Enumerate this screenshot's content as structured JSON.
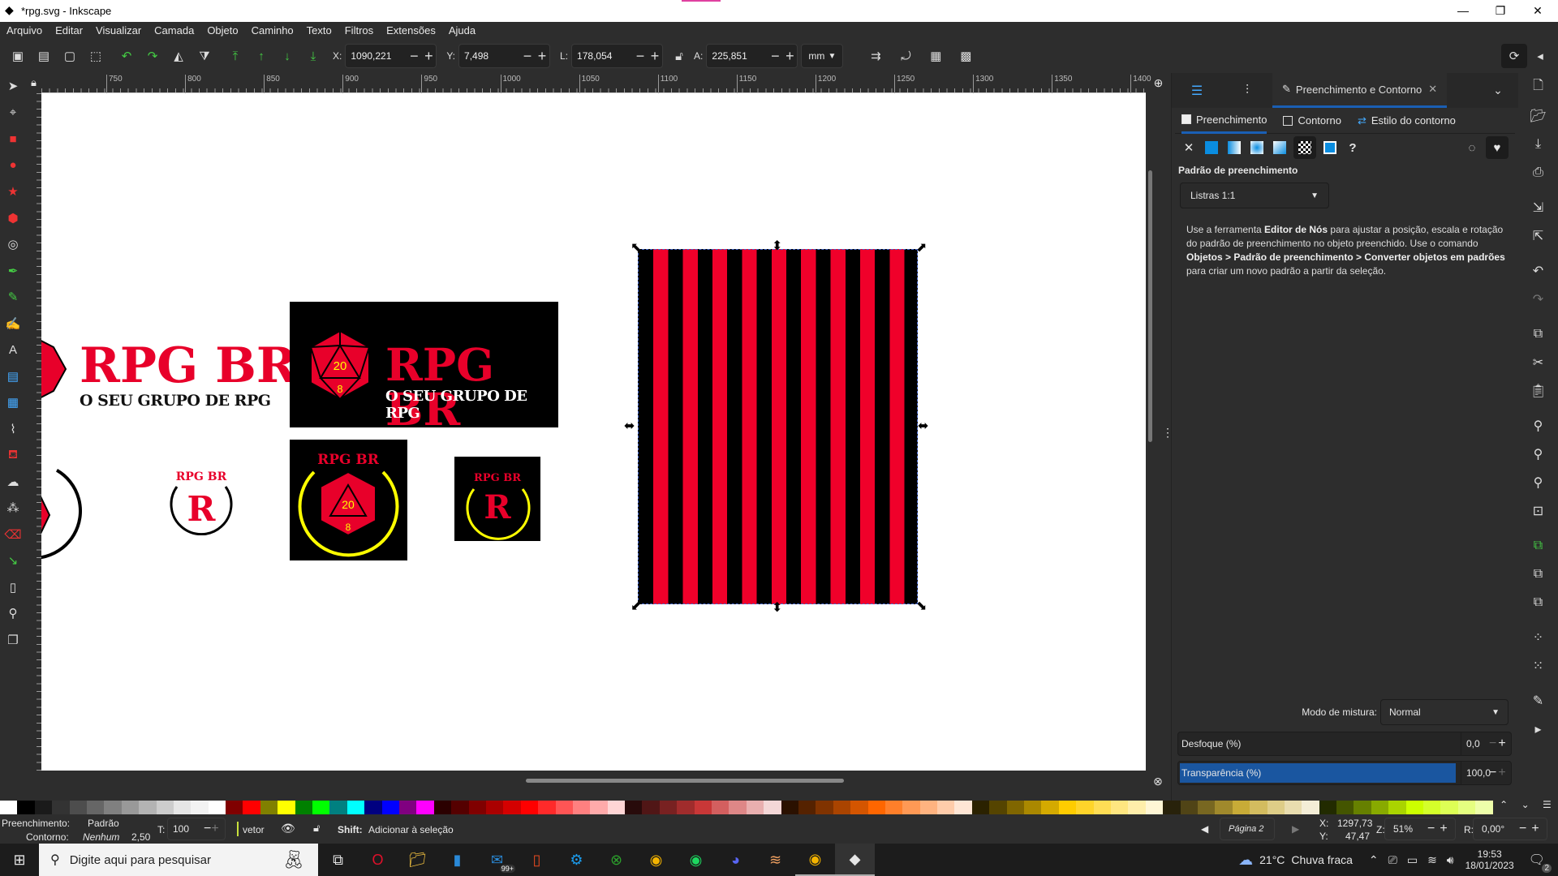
{
  "window": {
    "title": "*rpg.svg - Inkscape",
    "minimize": "—",
    "maximize": "❐",
    "close": "✕"
  },
  "menu": [
    "Arquivo",
    "Editar",
    "Visualizar",
    "Camada",
    "Objeto",
    "Caminho",
    "Texto",
    "Filtros",
    "Extensões",
    "Ajuda"
  ],
  "toolbar": {
    "x_label": "X:",
    "x": "1090,221",
    "y_label": "Y:",
    "y": "7,498",
    "w_label": "L:",
    "w": "178,054",
    "h_label": "A:",
    "h": "225,851",
    "unit": "mm",
    "minus": "−",
    "plus": "+"
  },
  "ruler": {
    "top_labels": [
      "750",
      "800",
      "850",
      "900",
      "950",
      "1000",
      "1050",
      "1100",
      "1150",
      "1200",
      "1250",
      "1300",
      "1350",
      "1400"
    ]
  },
  "canvas": {
    "logo_title": "RPG BR",
    "logo_subtitle": "O SEU GRUPO DE RPG",
    "badge_letter": "R",
    "die_faces": {
      "top": "20",
      "bottom": "8"
    },
    "colors": {
      "red": "#e8002a",
      "black": "#000000",
      "yellow": "#ffee00"
    },
    "stripes": {
      "pattern": "Listras 1:1",
      "colors": [
        "#000000",
        "#f0002a"
      ]
    }
  },
  "panel": {
    "tab_label": "Preenchimento e Contorno",
    "tab_close": "✕",
    "subtabs": [
      "Preenchimento",
      "Contorno",
      "Estilo do contorno"
    ],
    "fill_types": [
      "x-icon",
      "flat-color",
      "linear-gradient",
      "radial-gradient",
      "mesh-gradient",
      "pattern",
      "swatch",
      "unset"
    ],
    "selected_fill_type": "pattern",
    "section_title": "Padrão de preenchimento",
    "pattern_value": "Listras 1:1",
    "help": {
      "p1": "Use a ferramenta ",
      "b1": "Editor de Nós",
      "p2": " para ajustar a posição, escala e rotação do padrão de preenchimento no objeto preenchido. Use o comando ",
      "b2": "Objetos > Padrão de preenchimento > Converter objetos em padrões",
      "p3": " para criar um novo padrão a partir da seleção."
    },
    "blend_label": "Modo de mistura:",
    "blend_value": "Normal",
    "blur_label": "Desfoque (%)",
    "blur_value": "0,0",
    "blur_level": 0,
    "opacity_label": "Transparência (%)",
    "opacity_value": "100,0",
    "opacity_level": 100
  },
  "palette": [
    "#ffffff",
    "#000000",
    "#1a1a1a",
    "#333333",
    "#4d4d4d",
    "#666666",
    "#808080",
    "#999999",
    "#b3b3b3",
    "#cccccc",
    "#e6e6e6",
    "#f2f2f2",
    "#ffffff",
    "#800000",
    "#ff0000",
    "#808000",
    "#ffff00",
    "#008000",
    "#00ff00",
    "#008080",
    "#00ffff",
    "#000080",
    "#0000ff",
    "#800080",
    "#ff00ff",
    "#2b0000",
    "#550000",
    "#800000",
    "#aa0000",
    "#d40000",
    "#ff0000",
    "#ff2a2a",
    "#ff5555",
    "#ff8080",
    "#ffaaaa",
    "#ffd5d5",
    "#280b0b",
    "#501616",
    "#782121",
    "#a02c2c",
    "#c83737",
    "#d35f5f",
    "#de8787",
    "#e9afaf",
    "#f4d7d7",
    "#2b1100",
    "#552200",
    "#803300",
    "#aa4400",
    "#d45500",
    "#ff6600",
    "#ff7f2a",
    "#ff9955",
    "#ffb380",
    "#ffccaa",
    "#ffe6d5",
    "#2b2200",
    "#554400",
    "#806600",
    "#aa8800",
    "#d4aa00",
    "#ffcc00",
    "#ffd42a",
    "#ffdd55",
    "#ffe680",
    "#ffeeaa",
    "#fff6d5",
    "#28220b",
    "#504416",
    "#786721",
    "#a0892c",
    "#c8ab37",
    "#d3bc5f",
    "#decd87",
    "#e9ddaf",
    "#f4eed7",
    "#222b00",
    "#445500",
    "#668000",
    "#88aa00",
    "#aad400",
    "#ccff00",
    "#d4ff2a",
    "#ddff55",
    "#e5ff80",
    "#eeffaa"
  ],
  "status": {
    "fill_label": "Preenchimento:",
    "fill_value": "Padrão",
    "stroke_label": "Contorno:",
    "stroke_value": "Nenhum",
    "stroke_width": "2,50",
    "opacity_label": "T:",
    "opacity": "100",
    "layer": "vetor",
    "hint_key": "Shift:",
    "hint": " Adicionar à seleção",
    "page": "Página 2",
    "cx_label": "X:",
    "cx": "1297,73",
    "cy_label": "Y:",
    "cy": "47,47",
    "zoom_label": "Z:",
    "zoom": "51%",
    "rot_label": "R:",
    "rotation": "0,00°"
  },
  "taskbar": {
    "search_placeholder": "Digite aqui para pesquisar",
    "mail_badge": "99+",
    "weather_temp": "21°C",
    "weather_text": "Chuva fraca",
    "time": "19:53",
    "date": "18/01/2023",
    "notifications": "2"
  }
}
